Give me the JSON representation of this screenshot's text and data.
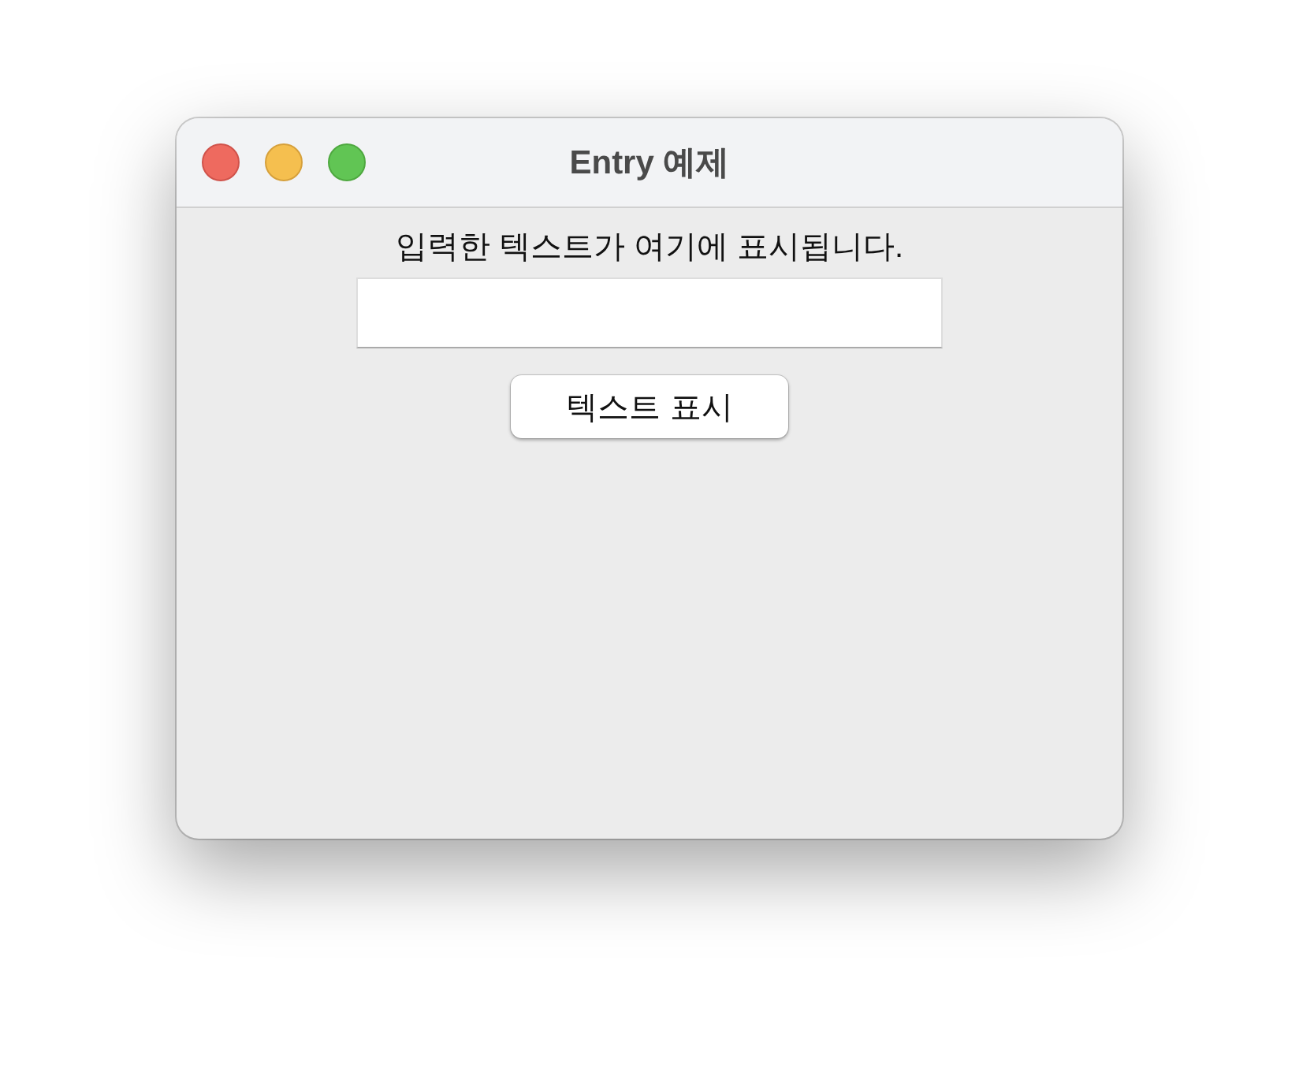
{
  "window": {
    "title": "Entry 예제"
  },
  "label": "입력한 텍스트가 여기에 표시됩니다.",
  "button": {
    "label": "텍스트 표시"
  }
}
